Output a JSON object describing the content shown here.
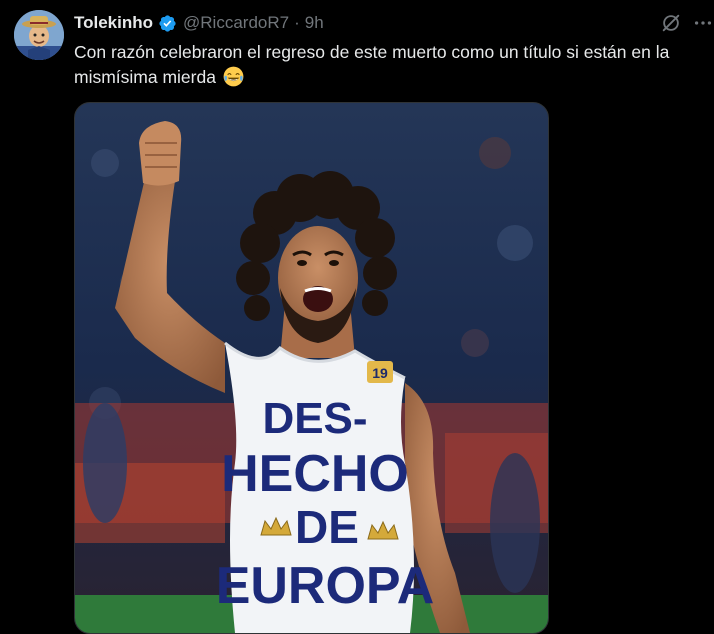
{
  "tweet": {
    "author_name": "Tolekinho",
    "handle": "@RiccardoR7",
    "separator": "·",
    "time": "9h",
    "text": "Con razón celebraron el regreso de este muerto como un título si están en la mismísima mierda",
    "emoji": "face-with-tears-of-joy",
    "verified_color": "#1d9bf0"
  },
  "media": {
    "shirt_text_lines": [
      "DES-",
      "HECHO",
      "DE",
      "EUROPA"
    ],
    "shirt_number": "19",
    "image_subject": "player-celebrating-photo"
  },
  "icons": {
    "grok": "grok-icon",
    "more": "more-icon"
  }
}
